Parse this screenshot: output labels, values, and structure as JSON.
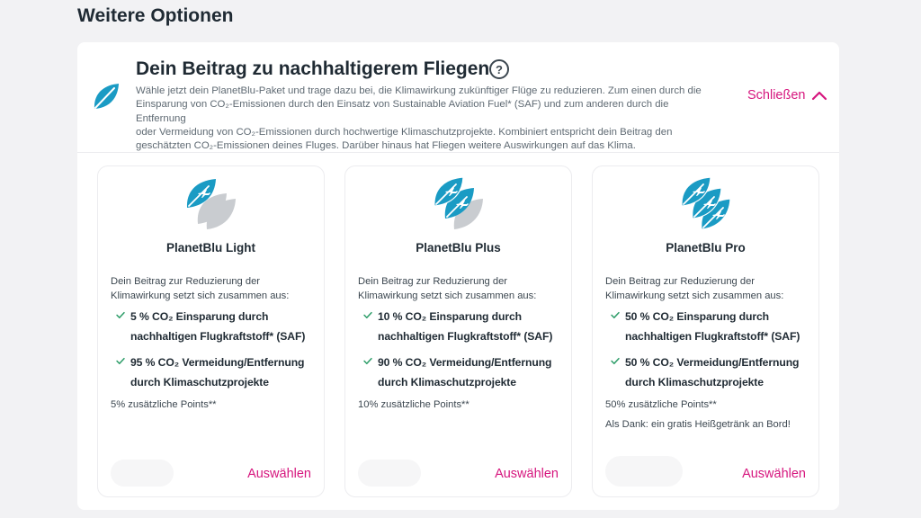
{
  "page": {
    "title": "Weitere Optionen"
  },
  "section": {
    "title": "Dein Beitrag zu nachhaltigerem Fliegen",
    "description_lines": [
      "Wähle jetzt dein PlanetBlu-Paket und trage dazu bei, die Klimawirkung zukünftiger Flüge zu reduzieren. Zum einen durch die",
      "Einsparung von CO₂-Emissionen durch den Einsatz von Sustainable Aviation Fuel* (SAF) und zum anderen durch die Entfernung",
      "oder Vermeidung von CO₂-Emissionen durch hochwertige Klimaschutzprojekte. Kombiniert entspricht dein Beitrag den",
      "geschätzten CO₂-Emissionen deines Fluges. Darüber hinaus hat Fliegen weitere Auswirkungen auf das Klima."
    ],
    "close_label": "Schließen",
    "help_glyph": "?"
  },
  "colors": {
    "accent": "#d6167e",
    "teal": "#1a9bc4",
    "leaf_gray": "#c9ccd0"
  },
  "cards": [
    {
      "title": "PlanetBlu Light",
      "intro_lines": [
        "Dein Beitrag zur Reduzierung der",
        "Klimawirkung setzt sich zusammen aus:"
      ],
      "benefit1_line1": "5 % CO₂ Einsparung durch",
      "benefit1_line2": "nachhaltigen Flugkraftstoff* (SAF)",
      "benefit2_line1": "95 % CO₂ Vermeidung/Entfernung",
      "benefit2_line2": "durch Klimaschutzprojekte",
      "points": "5% zusätzliche Points**",
      "extra": "",
      "select_label": "Auswählen",
      "icon": "planet-leaf-1-icon"
    },
    {
      "title": "PlanetBlu Plus",
      "intro_lines": [
        "Dein Beitrag zur Reduzierung der",
        "Klimawirkung setzt sich zusammen aus:"
      ],
      "benefit1_line1": "10 % CO₂ Einsparung durch",
      "benefit1_line2": "nachhaltigen Flugkraftstoff* (SAF)",
      "benefit2_line1": "90 % CO₂ Vermeidung/Entfernung",
      "benefit2_line2": "durch Klimaschutzprojekte",
      "points": "10% zusätzliche Points**",
      "extra": "",
      "select_label": "Auswählen",
      "icon": "planet-leaf-2-icon"
    },
    {
      "title": "PlanetBlu Pro",
      "intro_lines": [
        "Dein Beitrag zur Reduzierung der",
        "Klimawirkung setzt sich zusammen aus:"
      ],
      "benefit1_line1": "50 % CO₂ Einsparung durch",
      "benefit1_line2": "nachhaltigen Flugkraftstoff* (SAF)",
      "benefit2_line1": "50 % CO₂ Vermeidung/Entfernung",
      "benefit2_line2": "durch Klimaschutzprojekte",
      "points": "50% zusätzliche Points**",
      "extra": "Als Dank: ein gratis Heißgetränk an Bord!",
      "select_label": "Auswählen",
      "icon": "planet-leaf-3-icon"
    }
  ]
}
